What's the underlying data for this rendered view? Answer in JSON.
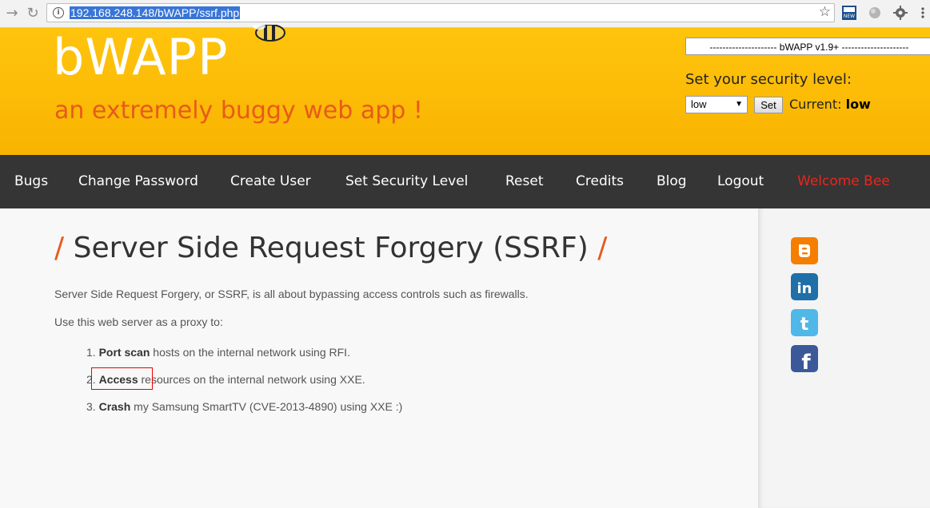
{
  "browser": {
    "url": "192.168.248.148/bWAPP/ssrf.php",
    "extensions": [
      "new-badge-icon",
      "globe-icon",
      "gear-icon",
      "menu-icon"
    ]
  },
  "header": {
    "logo": "bWAPP",
    "tagline": "an extremely buggy web app !",
    "bug_select_value": "--------------------- bWAPP v1.9+ ---------------------",
    "security_label": "Set your security level:",
    "security_select_value": "low",
    "set_button": "Set",
    "current_label": "Current:",
    "current_value": "low"
  },
  "menu": {
    "items": [
      "Bugs",
      "Change Password",
      "Create User",
      "Set Security Level",
      "Reset",
      "Credits",
      "Blog",
      "Logout"
    ],
    "welcome": "Welcome Bee"
  },
  "main": {
    "title": "Server Side Request Forgery (SSRF)",
    "slash": "/",
    "intro": "Server Side Request Forgery, or SSRF, is all about bypassing access controls such as firewalls.",
    "proxy_text": "Use this web server as a proxy to:",
    "list": [
      {
        "num": "1.",
        "bold": "Port scan",
        "rest": " hosts on the internal network using RFI."
      },
      {
        "num": "2.",
        "bold": "Access",
        "rest": " resources on the internal network using XXE."
      },
      {
        "num": "3.",
        "bold": "Crash",
        "rest": " my Samsung SmartTV (CVE-2013-4890) using XXE :)"
      }
    ]
  },
  "social": [
    {
      "name": "blogger-icon",
      "color": "#f57d00"
    },
    {
      "name": "linkedin-icon",
      "color": "#1f6fa8"
    },
    {
      "name": "twitter-icon",
      "color": "#4fb8e8"
    },
    {
      "name": "facebook-icon",
      "color": "#3b5998"
    }
  ],
  "colors": {
    "header": "#ffc40d",
    "menubar": "#353535",
    "accent": "#e85a1b",
    "welcome": "#e8261d"
  }
}
